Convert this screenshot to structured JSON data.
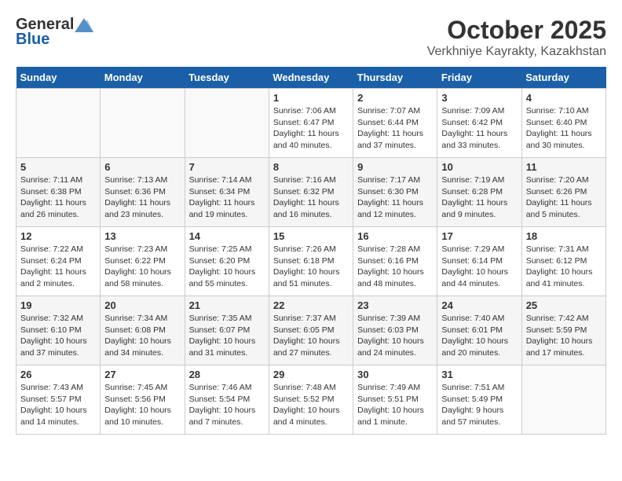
{
  "header": {
    "logo_general": "General",
    "logo_blue": "Blue",
    "month_title": "October 2025",
    "location": "Verkhniye Kayrakty, Kazakhstan"
  },
  "days_of_week": [
    "Sunday",
    "Monday",
    "Tuesday",
    "Wednesday",
    "Thursday",
    "Friday",
    "Saturday"
  ],
  "weeks": [
    [
      {
        "num": "",
        "info": ""
      },
      {
        "num": "",
        "info": ""
      },
      {
        "num": "",
        "info": ""
      },
      {
        "num": "1",
        "info": "Sunrise: 7:06 AM\nSunset: 6:47 PM\nDaylight: 11 hours\nand 40 minutes."
      },
      {
        "num": "2",
        "info": "Sunrise: 7:07 AM\nSunset: 6:44 PM\nDaylight: 11 hours\nand 37 minutes."
      },
      {
        "num": "3",
        "info": "Sunrise: 7:09 AM\nSunset: 6:42 PM\nDaylight: 11 hours\nand 33 minutes."
      },
      {
        "num": "4",
        "info": "Sunrise: 7:10 AM\nSunset: 6:40 PM\nDaylight: 11 hours\nand 30 minutes."
      }
    ],
    [
      {
        "num": "5",
        "info": "Sunrise: 7:11 AM\nSunset: 6:38 PM\nDaylight: 11 hours\nand 26 minutes."
      },
      {
        "num": "6",
        "info": "Sunrise: 7:13 AM\nSunset: 6:36 PM\nDaylight: 11 hours\nand 23 minutes."
      },
      {
        "num": "7",
        "info": "Sunrise: 7:14 AM\nSunset: 6:34 PM\nDaylight: 11 hours\nand 19 minutes."
      },
      {
        "num": "8",
        "info": "Sunrise: 7:16 AM\nSunset: 6:32 PM\nDaylight: 11 hours\nand 16 minutes."
      },
      {
        "num": "9",
        "info": "Sunrise: 7:17 AM\nSunset: 6:30 PM\nDaylight: 11 hours\nand 12 minutes."
      },
      {
        "num": "10",
        "info": "Sunrise: 7:19 AM\nSunset: 6:28 PM\nDaylight: 11 hours\nand 9 minutes."
      },
      {
        "num": "11",
        "info": "Sunrise: 7:20 AM\nSunset: 6:26 PM\nDaylight: 11 hours\nand 5 minutes."
      }
    ],
    [
      {
        "num": "12",
        "info": "Sunrise: 7:22 AM\nSunset: 6:24 PM\nDaylight: 11 hours\nand 2 minutes."
      },
      {
        "num": "13",
        "info": "Sunrise: 7:23 AM\nSunset: 6:22 PM\nDaylight: 10 hours\nand 58 minutes."
      },
      {
        "num": "14",
        "info": "Sunrise: 7:25 AM\nSunset: 6:20 PM\nDaylight: 10 hours\nand 55 minutes."
      },
      {
        "num": "15",
        "info": "Sunrise: 7:26 AM\nSunset: 6:18 PM\nDaylight: 10 hours\nand 51 minutes."
      },
      {
        "num": "16",
        "info": "Sunrise: 7:28 AM\nSunset: 6:16 PM\nDaylight: 10 hours\nand 48 minutes."
      },
      {
        "num": "17",
        "info": "Sunrise: 7:29 AM\nSunset: 6:14 PM\nDaylight: 10 hours\nand 44 minutes."
      },
      {
        "num": "18",
        "info": "Sunrise: 7:31 AM\nSunset: 6:12 PM\nDaylight: 10 hours\nand 41 minutes."
      }
    ],
    [
      {
        "num": "19",
        "info": "Sunrise: 7:32 AM\nSunset: 6:10 PM\nDaylight: 10 hours\nand 37 minutes."
      },
      {
        "num": "20",
        "info": "Sunrise: 7:34 AM\nSunset: 6:08 PM\nDaylight: 10 hours\nand 34 minutes."
      },
      {
        "num": "21",
        "info": "Sunrise: 7:35 AM\nSunset: 6:07 PM\nDaylight: 10 hours\nand 31 minutes."
      },
      {
        "num": "22",
        "info": "Sunrise: 7:37 AM\nSunset: 6:05 PM\nDaylight: 10 hours\nand 27 minutes."
      },
      {
        "num": "23",
        "info": "Sunrise: 7:39 AM\nSunset: 6:03 PM\nDaylight: 10 hours\nand 24 minutes."
      },
      {
        "num": "24",
        "info": "Sunrise: 7:40 AM\nSunset: 6:01 PM\nDaylight: 10 hours\nand 20 minutes."
      },
      {
        "num": "25",
        "info": "Sunrise: 7:42 AM\nSunset: 5:59 PM\nDaylight: 10 hours\nand 17 minutes."
      }
    ],
    [
      {
        "num": "26",
        "info": "Sunrise: 7:43 AM\nSunset: 5:57 PM\nDaylight: 10 hours\nand 14 minutes."
      },
      {
        "num": "27",
        "info": "Sunrise: 7:45 AM\nSunset: 5:56 PM\nDaylight: 10 hours\nand 10 minutes."
      },
      {
        "num": "28",
        "info": "Sunrise: 7:46 AM\nSunset: 5:54 PM\nDaylight: 10 hours\nand 7 minutes."
      },
      {
        "num": "29",
        "info": "Sunrise: 7:48 AM\nSunset: 5:52 PM\nDaylight: 10 hours\nand 4 minutes."
      },
      {
        "num": "30",
        "info": "Sunrise: 7:49 AM\nSunset: 5:51 PM\nDaylight: 10 hours\nand 1 minute."
      },
      {
        "num": "31",
        "info": "Sunrise: 7:51 AM\nSunset: 5:49 PM\nDaylight: 9 hours\nand 57 minutes."
      },
      {
        "num": "",
        "info": ""
      }
    ]
  ]
}
